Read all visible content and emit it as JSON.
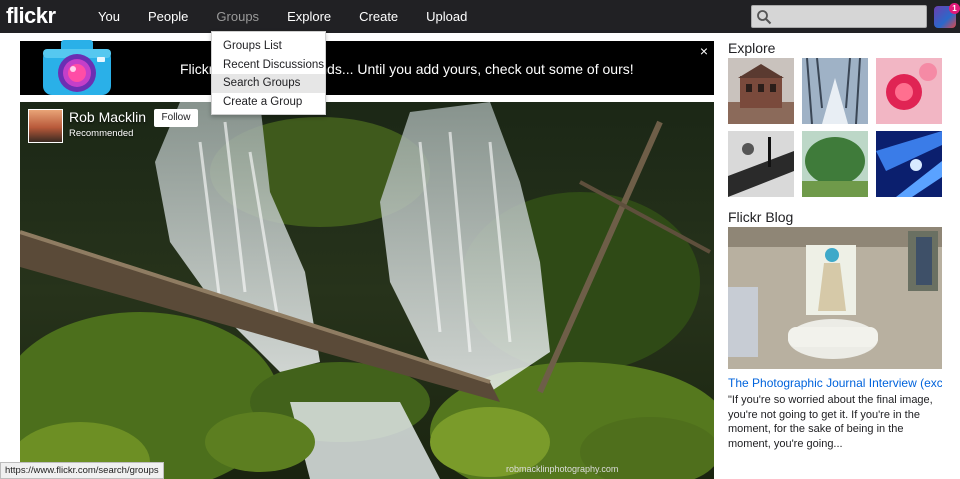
{
  "app": {
    "logo": "flickr"
  },
  "nav": [
    {
      "label": "You"
    },
    {
      "label": "People"
    },
    {
      "label": "Groups"
    },
    {
      "label": "Explore"
    },
    {
      "label": "Create"
    },
    {
      "label": "Upload"
    }
  ],
  "search": {
    "value": "",
    "placeholder": ""
  },
  "notifications": {
    "count": "1"
  },
  "groups_menu": {
    "items": [
      {
        "label": "Groups List"
      },
      {
        "label": "Recent Discussions"
      },
      {
        "label": "Search Groups"
      },
      {
        "label": "Create a Group"
      }
    ],
    "hovered_index": 2
  },
  "banner": {
    "text": "Flickr is better with friends... Until you add yours, check out some of ours!",
    "close": "×"
  },
  "photo": {
    "owner_name": "Rob Macklin",
    "owner_subtitle": "Recommended",
    "follow_label": "Follow",
    "watermark": "robmacklinphotography.com"
  },
  "sidebar": {
    "explore_heading": "Explore",
    "blog_heading": "Flickr Blog",
    "blog_title": "The Photographic Journal Interview (excer…",
    "blog_excerpt": "\"If you're so worried about the final image, you're not going to get it. If you're in the moment, for the sake of being in the moment, you're going..."
  },
  "status_bar": {
    "url": "https://www.flickr.com/search/groups"
  },
  "colors": {
    "topbar": "#212124",
    "link": "#0063dc",
    "brand_pink": "#ff0084"
  }
}
